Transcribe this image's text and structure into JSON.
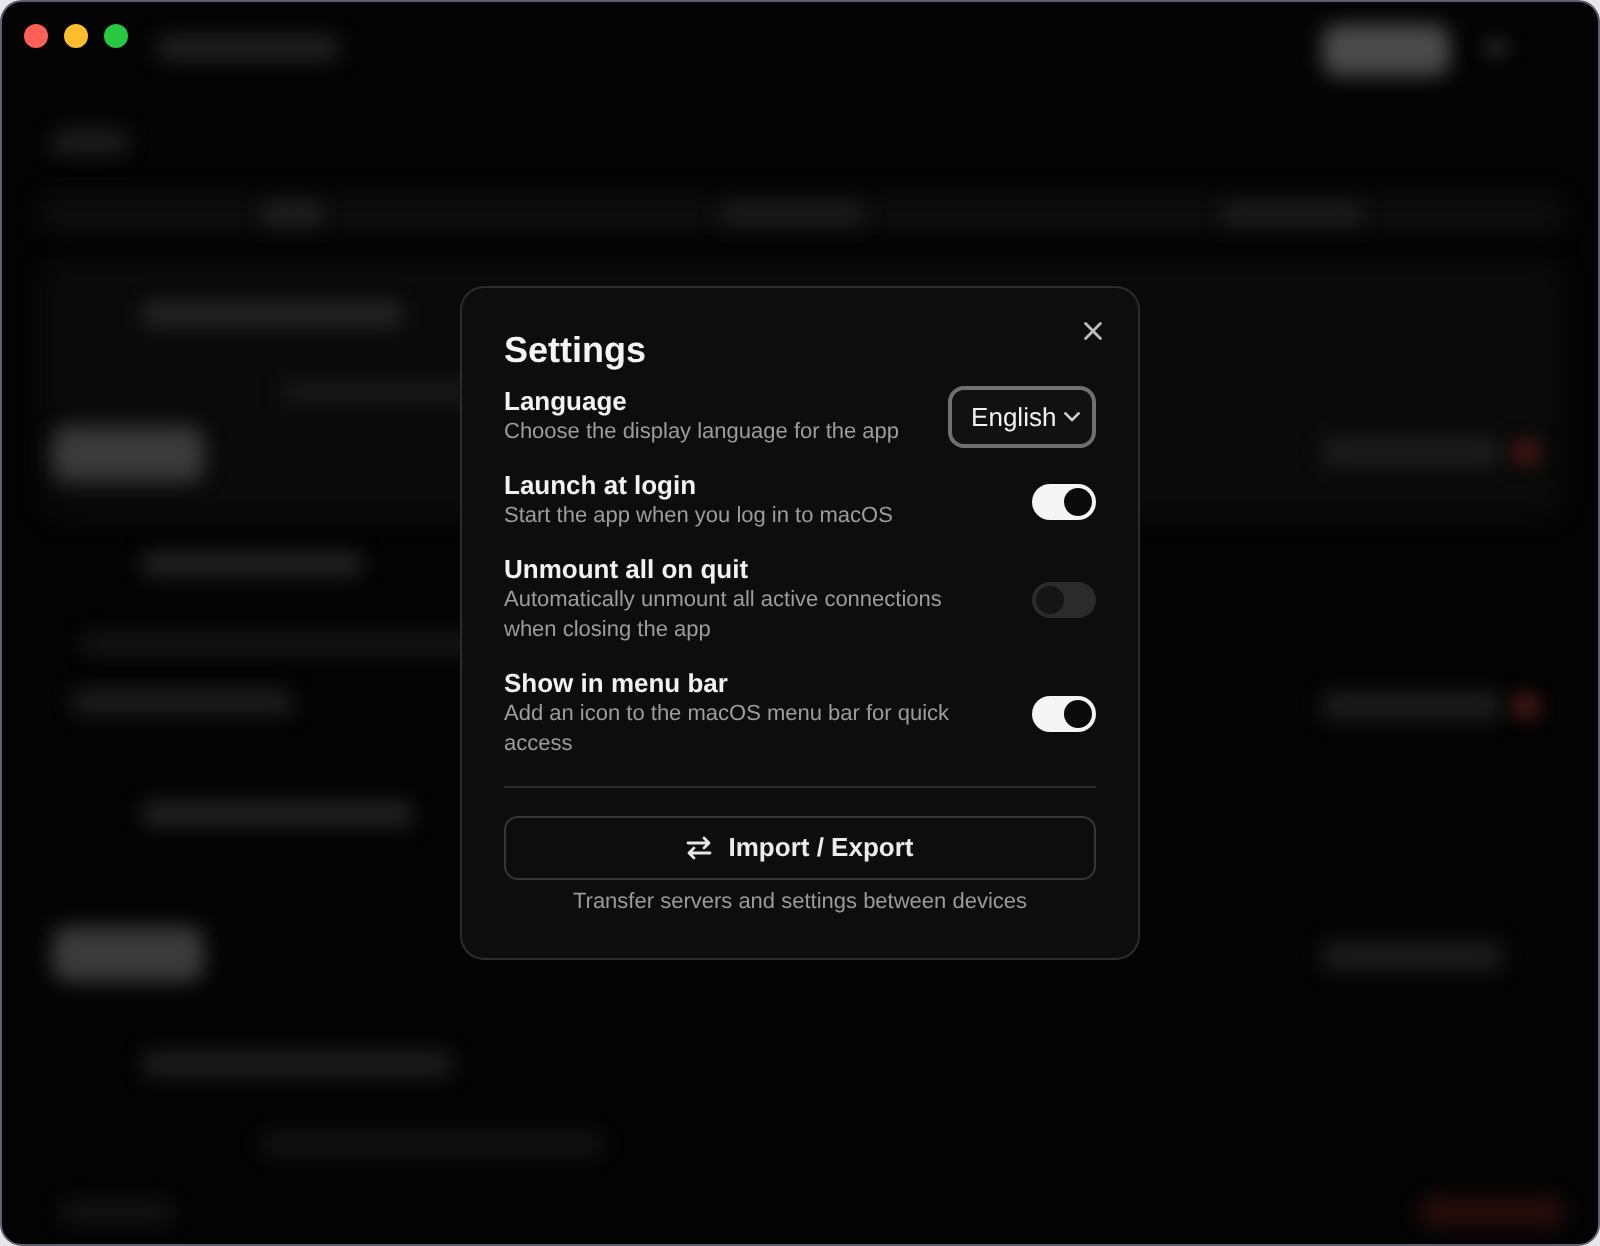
{
  "dialog": {
    "title": "Settings",
    "settings": [
      {
        "kind": "select",
        "label": "Language",
        "description": "Choose the display language for the app",
        "value": "English"
      },
      {
        "kind": "toggle",
        "label": "Launch at login",
        "description": "Start the app when you log in to macOS",
        "on": true
      },
      {
        "kind": "toggle",
        "label": "Unmount all on quit",
        "description": "Automatically unmount all active connections when closing the app",
        "on": false
      },
      {
        "kind": "toggle",
        "label": "Show in menu bar",
        "description": "Add an icon to the macOS menu bar for quick access",
        "on": true
      }
    ],
    "import_export": {
      "label": "Import / Export",
      "caption": "Transfer servers and settings between devices"
    }
  }
}
